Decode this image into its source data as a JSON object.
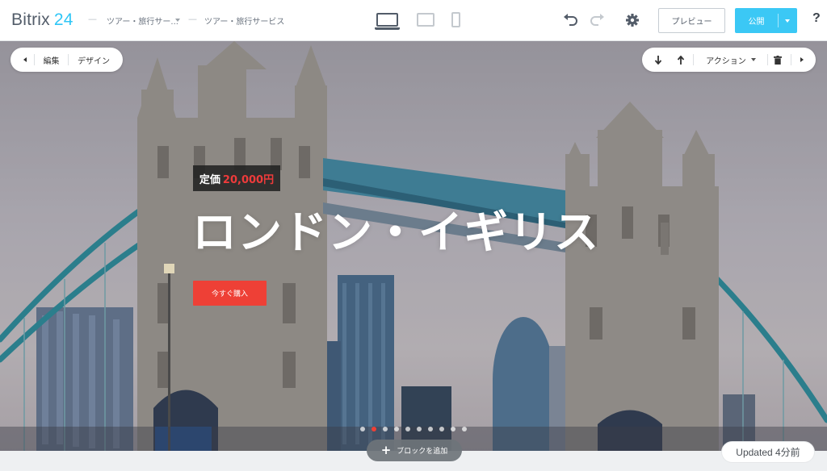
{
  "app": {
    "logo_name": "Bitrix",
    "logo_num": "24"
  },
  "breadcrumb": {
    "site": "ツアー・旅行サー...",
    "page": "ツアー・旅行サービス"
  },
  "toolbar": {
    "preview_label": "プレビュー",
    "publish_label": "公開",
    "help_label": "?"
  },
  "icons": {
    "desktop": "desktop-icon",
    "tablet": "tablet-icon",
    "phone": "phone-icon",
    "undo": "undo-icon",
    "redo": "redo-icon",
    "settings": "gear-icon",
    "arrow_down": "arrow-down-icon",
    "arrow_up": "arrow-up-icon",
    "delete": "trash-icon"
  },
  "block_left_panel": {
    "edit_label": "編集",
    "design_label": "デザイン"
  },
  "block_right_panel": {
    "actions_label": "アクション"
  },
  "hero": {
    "price_label": "定価",
    "price_value": "20,000円",
    "title": "ロンドン・イギリス",
    "buy_label": "今すぐ購入",
    "slide_count": 10,
    "active_slide": 2
  },
  "add_block_label": "ブロックを追加",
  "status": {
    "updated": "Updated 4分前"
  },
  "colors": {
    "accent_blue": "#3bc8f5",
    "logo_blue": "#2fc6f6",
    "cta_red": "#ee4036",
    "price_red": "#ee3b3b"
  }
}
